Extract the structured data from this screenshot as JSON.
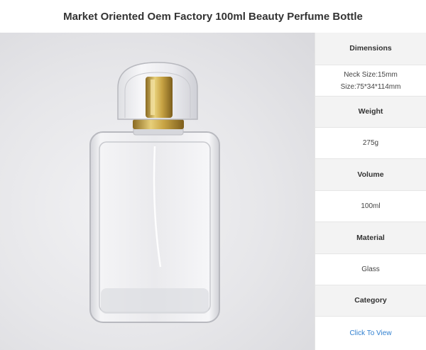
{
  "page": {
    "title": "Market Oriented Oem Factory 100ml Beauty Perfume Bottle"
  },
  "specs": {
    "dimensions_label": "Dimensions",
    "dimensions_value_1": "Neck Size:15mm",
    "dimensions_value_2": "Size:75*34*114mm",
    "weight_label": "Weight",
    "weight_value": "275g",
    "volume_label": "Volume",
    "volume_value": "100ml",
    "material_label": "Material",
    "material_value": "Glass",
    "category_label": "Category",
    "category_link": "Click To View"
  },
  "colors": {
    "link": "#2f7fd0",
    "label_bg": "#f3f3f3",
    "cap_gold": "#c9a545"
  }
}
